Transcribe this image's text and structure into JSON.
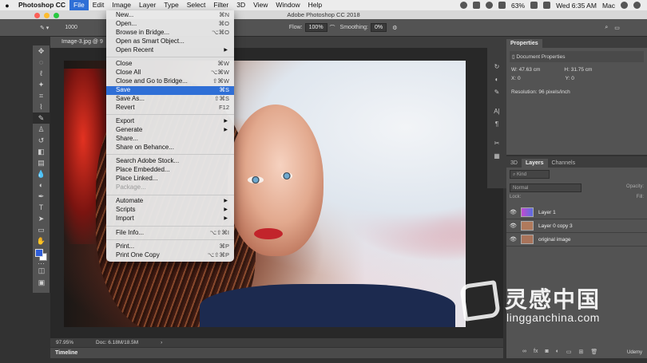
{
  "menubar": {
    "app": "Photoshop CC",
    "items": [
      "File",
      "Edit",
      "Image",
      "Layer",
      "Type",
      "Select",
      "Filter",
      "3D",
      "View",
      "Window",
      "Help"
    ],
    "battery": "63%",
    "clock": "Wed 6:35 AM",
    "user": "Mac"
  },
  "window_title": "Adobe Photoshop CC 2018",
  "options": {
    "brush_size": "1000",
    "flow_label": "Flow:",
    "flow_value": "100%",
    "smoothing_label": "Smoothing:",
    "smoothing_value": "0%"
  },
  "doc_tab": "Image-3.jpg @ 9",
  "file_menu": {
    "groups": [
      [
        {
          "label": "New...",
          "shortcut": "⌘N"
        },
        {
          "label": "Open...",
          "shortcut": "⌘O"
        },
        {
          "label": "Browse in Bridge...",
          "shortcut": "⌥⌘O"
        },
        {
          "label": "Open as Smart Object...",
          "shortcut": ""
        },
        {
          "label": "Open Recent",
          "shortcut": "",
          "submenu": true
        }
      ],
      [
        {
          "label": "Close",
          "shortcut": "⌘W"
        },
        {
          "label": "Close All",
          "shortcut": "⌥⌘W"
        },
        {
          "label": "Close and Go to Bridge...",
          "shortcut": "⇧⌘W"
        },
        {
          "label": "Save",
          "shortcut": "⌘S",
          "highlighted": true
        },
        {
          "label": "Save As...",
          "shortcut": "⇧⌘S"
        },
        {
          "label": "Revert",
          "shortcut": "F12"
        }
      ],
      [
        {
          "label": "Export",
          "shortcut": "",
          "submenu": true
        },
        {
          "label": "Generate",
          "shortcut": "",
          "submenu": true
        },
        {
          "label": "Share...",
          "shortcut": ""
        },
        {
          "label": "Share on Behance...",
          "shortcut": ""
        }
      ],
      [
        {
          "label": "Search Adobe Stock...",
          "shortcut": ""
        },
        {
          "label": "Place Embedded...",
          "shortcut": ""
        },
        {
          "label": "Place Linked...",
          "shortcut": ""
        },
        {
          "label": "Package...",
          "shortcut": "",
          "disabled": true
        }
      ],
      [
        {
          "label": "Automate",
          "shortcut": "",
          "submenu": true
        },
        {
          "label": "Scripts",
          "shortcut": "",
          "submenu": true
        },
        {
          "label": "Import",
          "shortcut": "",
          "submenu": true
        }
      ],
      [
        {
          "label": "File Info...",
          "shortcut": "⌥⇧⌘I"
        }
      ],
      [
        {
          "label": "Print...",
          "shortcut": "⌘P"
        },
        {
          "label": "Print One Copy",
          "shortcut": "⌥⇧⌘P"
        }
      ]
    ]
  },
  "status_bar": {
    "zoom": "97.95%",
    "doc": "Doc: 6.18M/18.5M"
  },
  "timeline_label": "Timeline",
  "properties": {
    "tab": "Properties",
    "heading": "Document Properties",
    "w_label": "W:",
    "w_value": "47.63 cm",
    "h_label": "H:",
    "h_value": "31.75 cm",
    "x_label": "X:",
    "x_value": "0",
    "y_label": "Y:",
    "y_value": "0",
    "resolution": "Resolution: 96 pixels/inch"
  },
  "layers_panel": {
    "tabs": [
      "3D",
      "Layers",
      "Channels"
    ],
    "kind_filter": "Kind",
    "blend_mode": "Normal",
    "opacity_label": "Opacity:",
    "lock_label": "Lock:",
    "fill_label": "Fill:",
    "layers": [
      {
        "name": "Layer 1",
        "thumb_color": "#8a5be0"
      },
      {
        "name": "Layer 0 copy 3",
        "thumb_color": "#b07a5c"
      },
      {
        "name": "original image",
        "thumb_color": "#a8735a"
      }
    ]
  },
  "watermark": {
    "cn": "灵感中国",
    "url": "lingganchina.com"
  },
  "udemy": "Udemy"
}
